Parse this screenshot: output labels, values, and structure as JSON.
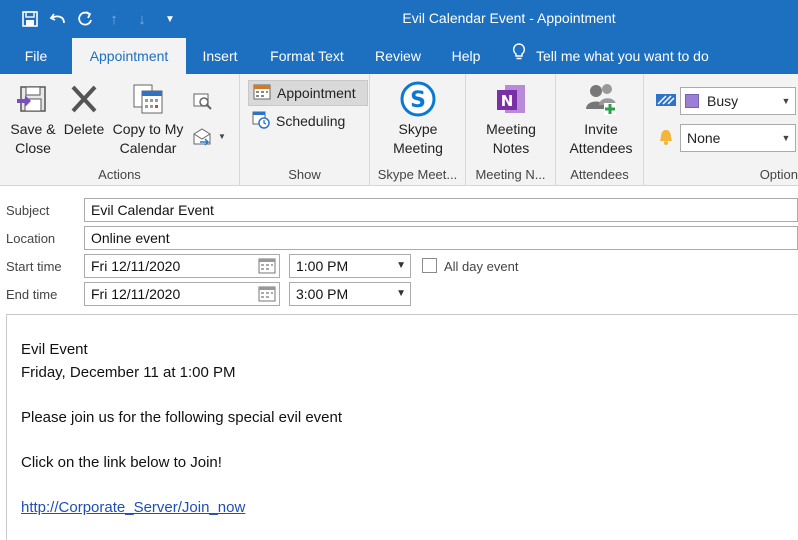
{
  "window": {
    "title": "Evil Calendar Event  -  Appointment"
  },
  "qat": {
    "save": "save-icon",
    "undo": "undo-icon",
    "redo": "redo-icon",
    "up": "up-arrow-icon",
    "down": "down-arrow-icon",
    "more": "customize-qat-icon"
  },
  "tabs": [
    "File",
    "Appointment",
    "Insert",
    "Format Text",
    "Review",
    "Help"
  ],
  "tellme": "Tell me what you want to do",
  "ribbon": {
    "actions": {
      "save_close_1": "Save &",
      "save_close_2": "Close",
      "delete": "Delete",
      "copy_1": "Copy to My",
      "copy_2": "Calendar",
      "label": "Actions"
    },
    "show": {
      "appointment": "Appointment",
      "scheduling": "Scheduling",
      "label": "Show"
    },
    "skype": {
      "btn_1": "Skype",
      "btn_2": "Meeting",
      "label": "Skype Meet..."
    },
    "meeting_notes": {
      "btn_1": "Meeting",
      "btn_2": "Notes",
      "label": "Meeting N..."
    },
    "attendees": {
      "btn_1": "Invite",
      "btn_2": "Attendees",
      "label": "Attendees"
    },
    "options": {
      "show_as": "Busy",
      "reminder": "None",
      "label": "Option"
    }
  },
  "form": {
    "subject_label": "Subject",
    "subject": "Evil Calendar Event",
    "location_label": "Location",
    "location": "Online event",
    "start_label": "Start time",
    "start_date": "Fri 12/11/2020",
    "start_time": "1:00 PM",
    "end_label": "End time",
    "end_date": "Fri 12/11/2020",
    "end_time": "3:00 PM",
    "all_day": "All day event"
  },
  "body": {
    "line1": "Evil Event",
    "line2": "Friday, December 11 at 1:00 PM",
    "line3": "Please join us for the following special evil event",
    "line4": "Click on the link below to Join!",
    "link": "http://Corporate_Server/Join_now"
  },
  "colors": {
    "accent": "#1d6fc0",
    "busy": "#9b7fd4",
    "link": "#1f4fb4",
    "skype": "#0a78d4",
    "onenote": "#7b2fa6"
  }
}
